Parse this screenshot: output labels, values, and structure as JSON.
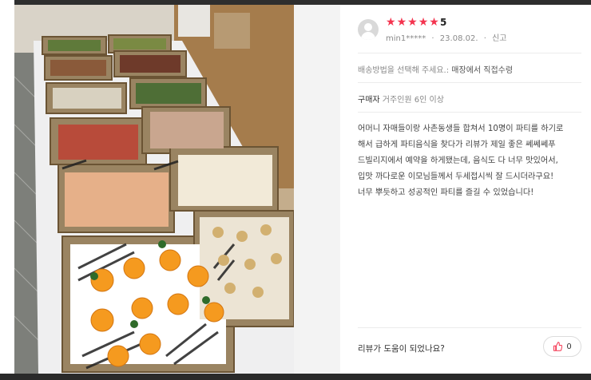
{
  "review": {
    "rating": "5",
    "star_count": 5,
    "user": "min1*****",
    "date": "23.08.02.",
    "separator": "·",
    "report_label": "신고",
    "option_label": "배송방법을 선택해 주세요.:",
    "option_value": "매장에서 직접수령",
    "buyer_label": "구매자",
    "buyer_value": "거주인원 6인 이상",
    "content_lines": [
      "어머니 자매들이랑 사촌동생들 합쳐서 10명이 파티를 하기로",
      "해서 급하게 파티음식을 찾다가 리뷰가 제일 좋은 쎄쎄쎄푸",
      "드빌리지에서 예약을 하게됐는데, 음식도 다 너무 맛있어서,",
      "입맛 까다로운 이모님들께서 두세접시씩 잘 드시더라구요!",
      "너무 뿌듯하고 성공적인 파티를 즐길 수 있었습니다!"
    ],
    "helpful_question": "리뷰가 도움이 되었나요?",
    "like_count": "0"
  },
  "colors": {
    "star": "#f4344f",
    "accent_like": "#f4344f"
  },
  "icons": {
    "avatar": "default-user-icon",
    "like": "thumbs-up-icon",
    "star": "star-icon"
  },
  "photo": {
    "subject": "party platters"
  }
}
